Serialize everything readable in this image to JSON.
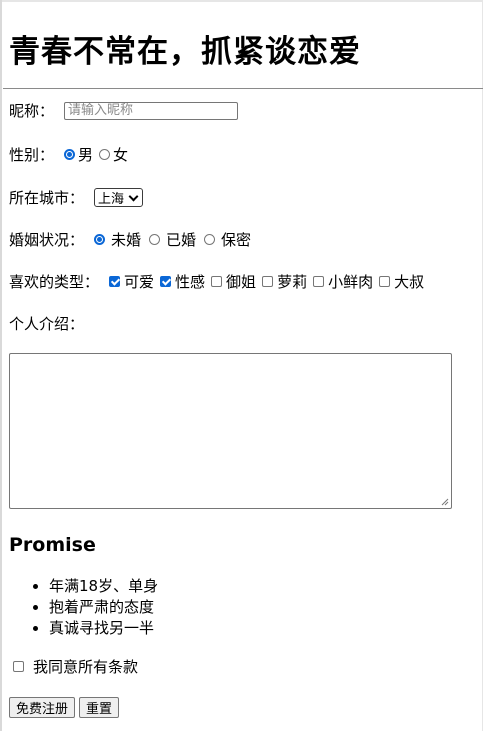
{
  "title": "青春不常在，抓紧谈恋爱",
  "nickname": {
    "label": "昵称：",
    "placeholder": "请输入昵称"
  },
  "gender": {
    "label": "性别：",
    "options": [
      "男",
      "女"
    ],
    "selected": "男"
  },
  "city": {
    "label": "所在城市：",
    "selected": "上海"
  },
  "marital": {
    "label": "婚姻状况：",
    "options": [
      "未婚",
      "已婚",
      "保密"
    ],
    "selected": "未婚"
  },
  "types": {
    "label": "喜欢的类型：",
    "options": [
      {
        "text": "可爱",
        "checked": true
      },
      {
        "text": "性感",
        "checked": true
      },
      {
        "text": "御姐",
        "checked": false
      },
      {
        "text": "萝莉",
        "checked": false
      },
      {
        "text": "小鲜肉",
        "checked": false
      },
      {
        "text": "大叔",
        "checked": false
      }
    ]
  },
  "intro": {
    "label": "个人介绍：",
    "value": ""
  },
  "promise": {
    "heading": "Promise",
    "items": [
      "年满18岁、单身",
      "抱着严肃的态度",
      "真诚寻找另一半"
    ]
  },
  "agree": {
    "label": "我同意所有条款",
    "checked": false
  },
  "buttons": {
    "submit": "免费注册",
    "reset": "重置"
  },
  "colors": {
    "accent": "#0b67d6"
  }
}
